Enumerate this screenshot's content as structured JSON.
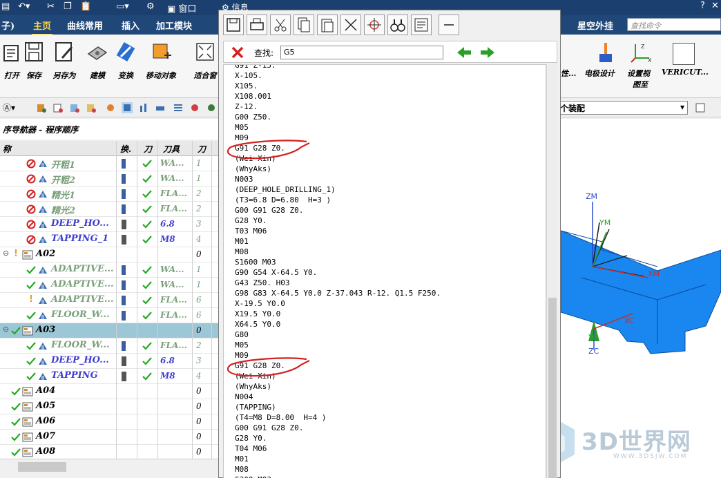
{
  "titlebar": {
    "dialog_title": "信息"
  },
  "tabs": [
    {
      "label": "子)",
      "active": false
    },
    {
      "label": "主页",
      "active": true
    },
    {
      "label": "曲线常用",
      "active": false
    },
    {
      "label": "插入",
      "active": false
    },
    {
      "label": "加工模块",
      "active": false
    },
    {
      "label": "星空外挂",
      "active": false
    }
  ],
  "search": {
    "placeholder": "查找命令"
  },
  "ribbon_left": [
    {
      "label": "打开",
      "icon": "open-folder-icon"
    },
    {
      "label": "保存",
      "icon": "save-icon"
    },
    {
      "label": "另存为",
      "icon": "save-as-icon"
    },
    {
      "label": "建模",
      "icon": "modeling-icon"
    },
    {
      "label": "变换",
      "icon": "transform-icon"
    },
    {
      "label": "移动对象",
      "icon": "move-object-icon"
    },
    {
      "label": "适合窗",
      "icon": "fit-window-icon"
    }
  ],
  "ribbon_right": [
    {
      "label": "性..."
    },
    {
      "label": "电极设计"
    },
    {
      "label": "设置视"
    },
    {
      "label": "图至"
    },
    {
      "label": "VERICUT..."
    }
  ],
  "assembly_combo": {
    "value": "个装配"
  },
  "navigator": {
    "title": "序导航器 - 程序顺序",
    "headers": [
      "称",
      "换.",
      "刀",
      "刀具",
      "刀"
    ],
    "rows": [
      {
        "name": "开粗1",
        "style": "grey",
        "status": "none",
        "tool": "WA...",
        "num": "1"
      },
      {
        "name": "开粗2",
        "style": "grey",
        "status": "none",
        "tool": "WA...",
        "num": "1"
      },
      {
        "name": "精光1",
        "style": "grey",
        "status": "none",
        "tool": "FLA...",
        "num": "2"
      },
      {
        "name": "精光2",
        "style": "grey",
        "status": "none",
        "tool": "FLA...",
        "num": "2"
      },
      {
        "name": "DEEP_HO...",
        "style": "op",
        "status": "none",
        "tool": "6.8",
        "num": "3"
      },
      {
        "name": "TAPPING_1",
        "style": "op",
        "status": "none",
        "tool": "M8",
        "num": "4"
      },
      {
        "name": "A02",
        "style": "blk",
        "status": "warn",
        "tool": "",
        "num": "0"
      },
      {
        "name": "ADAPTIVE...",
        "style": "grey",
        "status": "ok",
        "tool": "WA...",
        "num": "1"
      },
      {
        "name": "ADAPTIVE...",
        "style": "grey",
        "status": "ok",
        "tool": "WA...",
        "num": "1"
      },
      {
        "name": "ADAPTIVE...",
        "style": "grey",
        "status": "warn",
        "tool": "FLA...",
        "num": "6"
      },
      {
        "name": "FLOOR_W...",
        "style": "grey",
        "status": "ok",
        "tool": "FLA...",
        "num": "6"
      },
      {
        "name": "A03",
        "style": "blk",
        "status": "ok",
        "tool": "",
        "num": "0"
      },
      {
        "name": "FLOOR_W...",
        "style": "grey",
        "status": "ok",
        "tool": "FLA...",
        "num": "2"
      },
      {
        "name": "DEEP_HO...",
        "style": "op",
        "status": "ok",
        "tool": "6.8",
        "num": "3"
      },
      {
        "name": "TAPPING",
        "style": "op",
        "status": "ok",
        "tool": "M8",
        "num": "4"
      },
      {
        "name": "A04",
        "style": "blk",
        "status": "ok",
        "tool": "",
        "num": "0"
      },
      {
        "name": "A05",
        "style": "blk",
        "status": "ok",
        "tool": "",
        "num": "0"
      },
      {
        "name": "A06",
        "style": "blk",
        "status": "ok",
        "tool": "",
        "num": "0"
      },
      {
        "name": "A07",
        "style": "blk",
        "status": "ok",
        "tool": "",
        "num": "0"
      },
      {
        "name": "A08",
        "style": "blk",
        "status": "ok",
        "tool": "",
        "num": "0"
      }
    ],
    "selected_row": "A03"
  },
  "info_dialog": {
    "find_label": "查找:",
    "find_value": "G5",
    "code_lines": [
      "G91 Z-15.",
      "X-105.",
      "X105.",
      "X108.001",
      "Z-12.",
      "G00 Z50.",
      "M05",
      "M09",
      "G91 G28 Z0.",
      "(Wei Xin)",
      "(WhyAks)",
      "N003",
      "(DEEP_HOLE_DRILLING_1)",
      "(T3=6.8 D=6.80  H=3 )",
      "G00 G91 G28 Z0.",
      "G28 Y0.",
      "T03 M06",
      "M01",
      "M08",
      "S1600 M03",
      "G90 G54 X-64.5 Y0.",
      "G43 Z50. H03",
      "G98 G83 X-64.5 Y0.0 Z-37.043 R-12. Q1.5 F250.",
      "X-19.5 Y0.0",
      "X19.5 Y0.0",
      "X64.5 Y0.0",
      "G80",
      "M05",
      "M09",
      "G91 G28 Z0.",
      "(Wei Xin)",
      "(WhyAks)",
      "N004",
      "(TAPPING)",
      "(T4=M8 D=8.00  H=4 )",
      "G00 G91 G28 Z0.",
      "G28 Y0.",
      "T04 M06",
      "M01",
      "M08",
      "S300 M03"
    ]
  },
  "viewport": {
    "axis_labels": [
      "ZM",
      "YM",
      "XM",
      "XC",
      "YC",
      "ZC"
    ]
  },
  "watermark": {
    "brand": "3D世界网",
    "url": "WWW.3DSJW.COM"
  },
  "colors": {
    "titlebar": "#1b3f6e",
    "tab_active": "#ffd84a",
    "model_blue": "#1a86f0",
    "highlight_red": "#d42020",
    "selected_row": "#9cc7d6"
  }
}
